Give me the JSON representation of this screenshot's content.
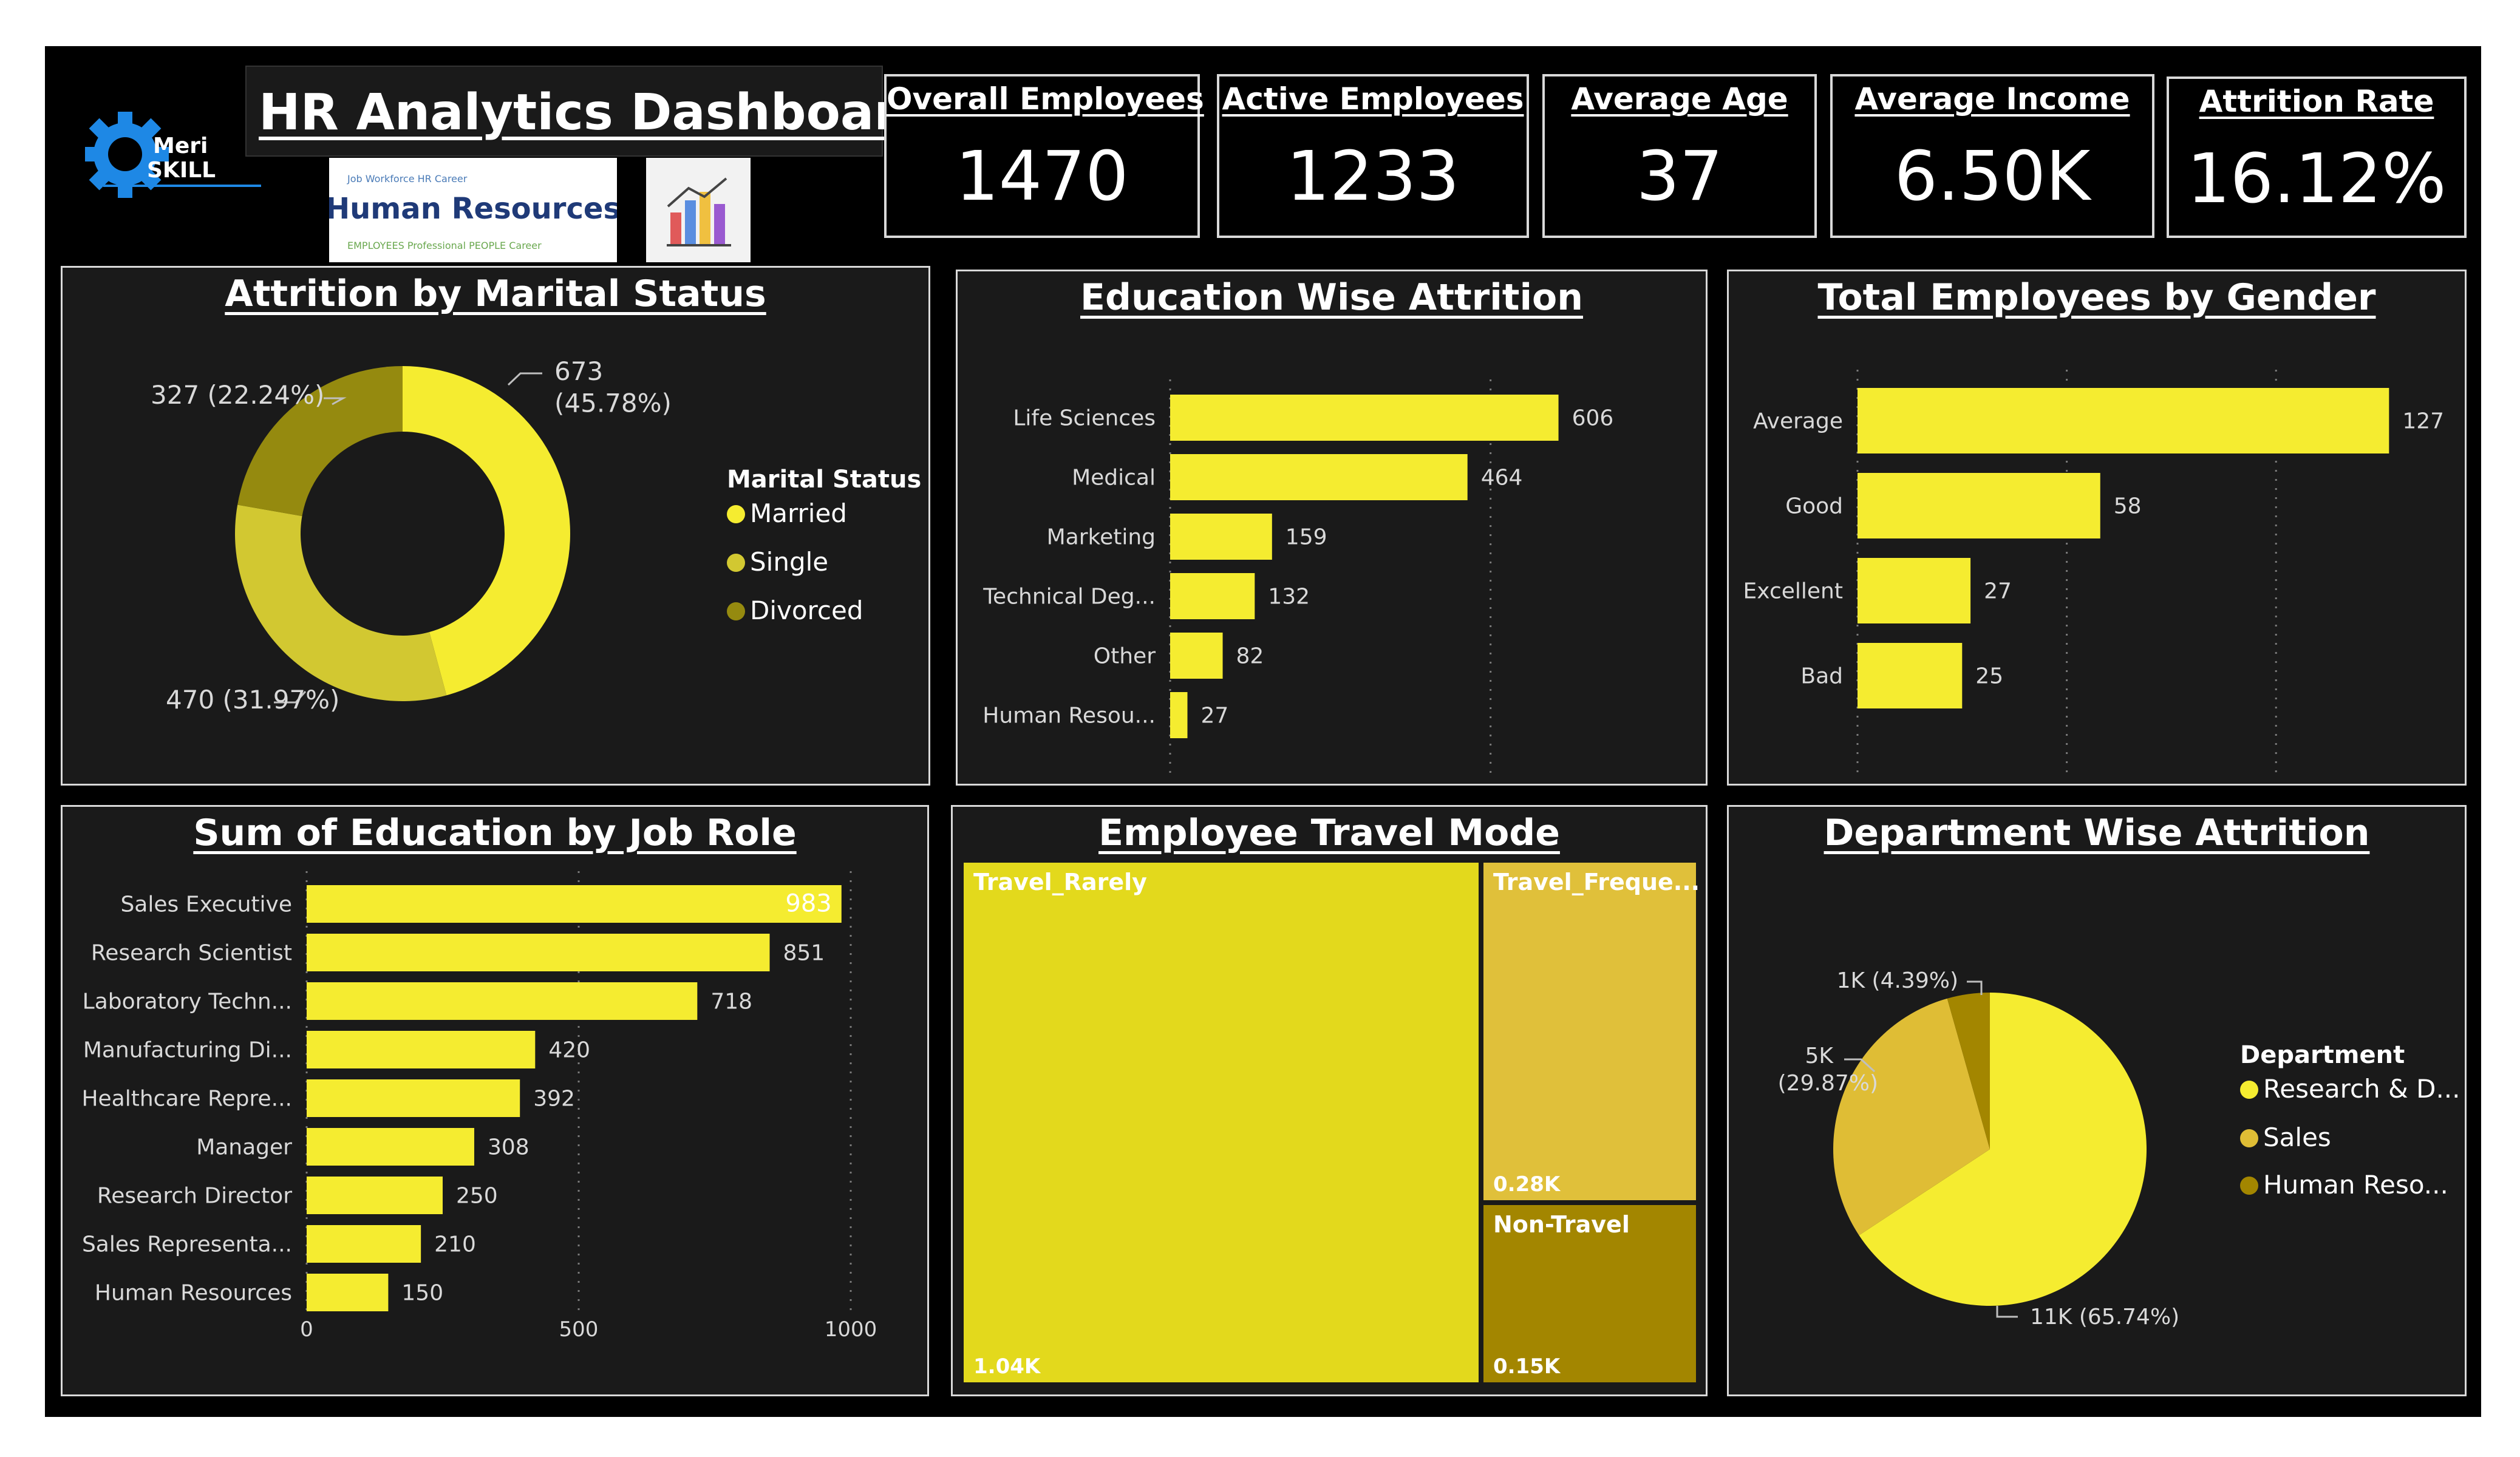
{
  "header": {
    "title": "HR Analytics Dashboards",
    "logo_text_top": "Meri",
    "logo_text_bottom": "SKILL",
    "hr_image_text": "Human Resources"
  },
  "kpis": [
    {
      "label": "Overall Employees",
      "value": "1470"
    },
    {
      "label": "Active Employees",
      "value": "1233"
    },
    {
      "label": "Average Age",
      "value": "37"
    },
    {
      "label": "Average Income",
      "value": "6.50K"
    },
    {
      "label": "Attrition Rate",
      "value": "16.12%"
    }
  ],
  "panels": {
    "marital": {
      "title": "Attrition by Marital Status"
    },
    "education": {
      "title": "Education Wise Attrition"
    },
    "gender": {
      "title": "Total Employees by Gender"
    },
    "jobrole": {
      "title": "Sum of Education by Job Role"
    },
    "travel": {
      "title": "Employee Travel Mode"
    },
    "department": {
      "title": "Department Wise Attrition"
    }
  },
  "colors": {
    "yellow": "#f5ec30",
    "married": "#f5ec30",
    "single": "#d2c831",
    "divorced": "#958a0f",
    "travel_rarely": "#e3d91c",
    "travel_frequently": "#e0c03a",
    "non_travel": "#a38600",
    "research": "#f5ec30",
    "sales": "#dfbd35",
    "hr": "#a38600"
  },
  "chart_data": [
    {
      "type": "pie",
      "variant": "donut",
      "title": "Attrition by Marital Status",
      "legend_title": "Marital Status",
      "legend_position": "right",
      "slices": [
        {
          "name": "Married",
          "value": 673,
          "label_line1": "673",
          "label_line2": "(45.78%)"
        },
        {
          "name": "Single",
          "value": 470,
          "label_line1": "470 (31.97%)",
          "label_line2": ""
        },
        {
          "name": "Divorced",
          "value": 327,
          "label_line1": "327 (22.24%)",
          "label_line2": ""
        }
      ]
    },
    {
      "type": "bar",
      "orientation": "horizontal",
      "title": "Education Wise Attrition",
      "categories": [
        "Life Sciences",
        "Medical",
        "Marketing",
        "Technical Deg...",
        "Other",
        "Human Resou..."
      ],
      "values": [
        606,
        464,
        159,
        132,
        82,
        27
      ],
      "xlim": [
        0,
        650
      ],
      "ticks": [
        0,
        500
      ]
    },
    {
      "type": "bar",
      "orientation": "horizontal",
      "title": "Total Employees by Gender",
      "categories": [
        "Average",
        "Good",
        "Excellent",
        "Bad"
      ],
      "values": [
        127,
        58,
        27,
        25
      ],
      "xlim": [
        0,
        130
      ],
      "ticks": [
        0,
        50,
        100
      ]
    },
    {
      "type": "bar",
      "orientation": "horizontal",
      "title": "Sum of Education by Job Role",
      "categories": [
        "Sales Executive",
        "Research Scientist",
        "Laboratory Techn...",
        "Manufacturing Di...",
        "Healthcare Repre...",
        "Manager",
        "Research Director",
        "Sales Representa...",
        "Human Resources"
      ],
      "values": [
        983,
        851,
        718,
        420,
        392,
        308,
        250,
        210,
        150
      ],
      "xlim": [
        0,
        1000
      ],
      "ticks": [
        0,
        500,
        1000
      ]
    },
    {
      "type": "treemap",
      "title": "Employee Travel Mode",
      "items": [
        {
          "name": "Travel_Rarely",
          "label": "Travel_Rarely",
          "value": 1040,
          "value_label": "1.04K"
        },
        {
          "name": "Travel_Frequently",
          "label": "Travel_Freque...",
          "value": 280,
          "value_label": "0.28K"
        },
        {
          "name": "Non-Travel",
          "label": "Non-Travel",
          "value": 150,
          "value_label": "0.15K"
        }
      ]
    },
    {
      "type": "pie",
      "title": "Department Wise Attrition",
      "legend_title": "Department",
      "legend_position": "right",
      "slices": [
        {
          "name": "Research & D...",
          "value": 65.74,
          "label_line1": "11K (65.74%)",
          "label_line2": ""
        },
        {
          "name": "Sales",
          "value": 29.87,
          "label_line1": "5K",
          "label_line2": "(29.87%)"
        },
        {
          "name": "Human Reso...",
          "value": 4.39,
          "label_line1": "1K (4.39%)",
          "label_line2": ""
        }
      ]
    }
  ]
}
